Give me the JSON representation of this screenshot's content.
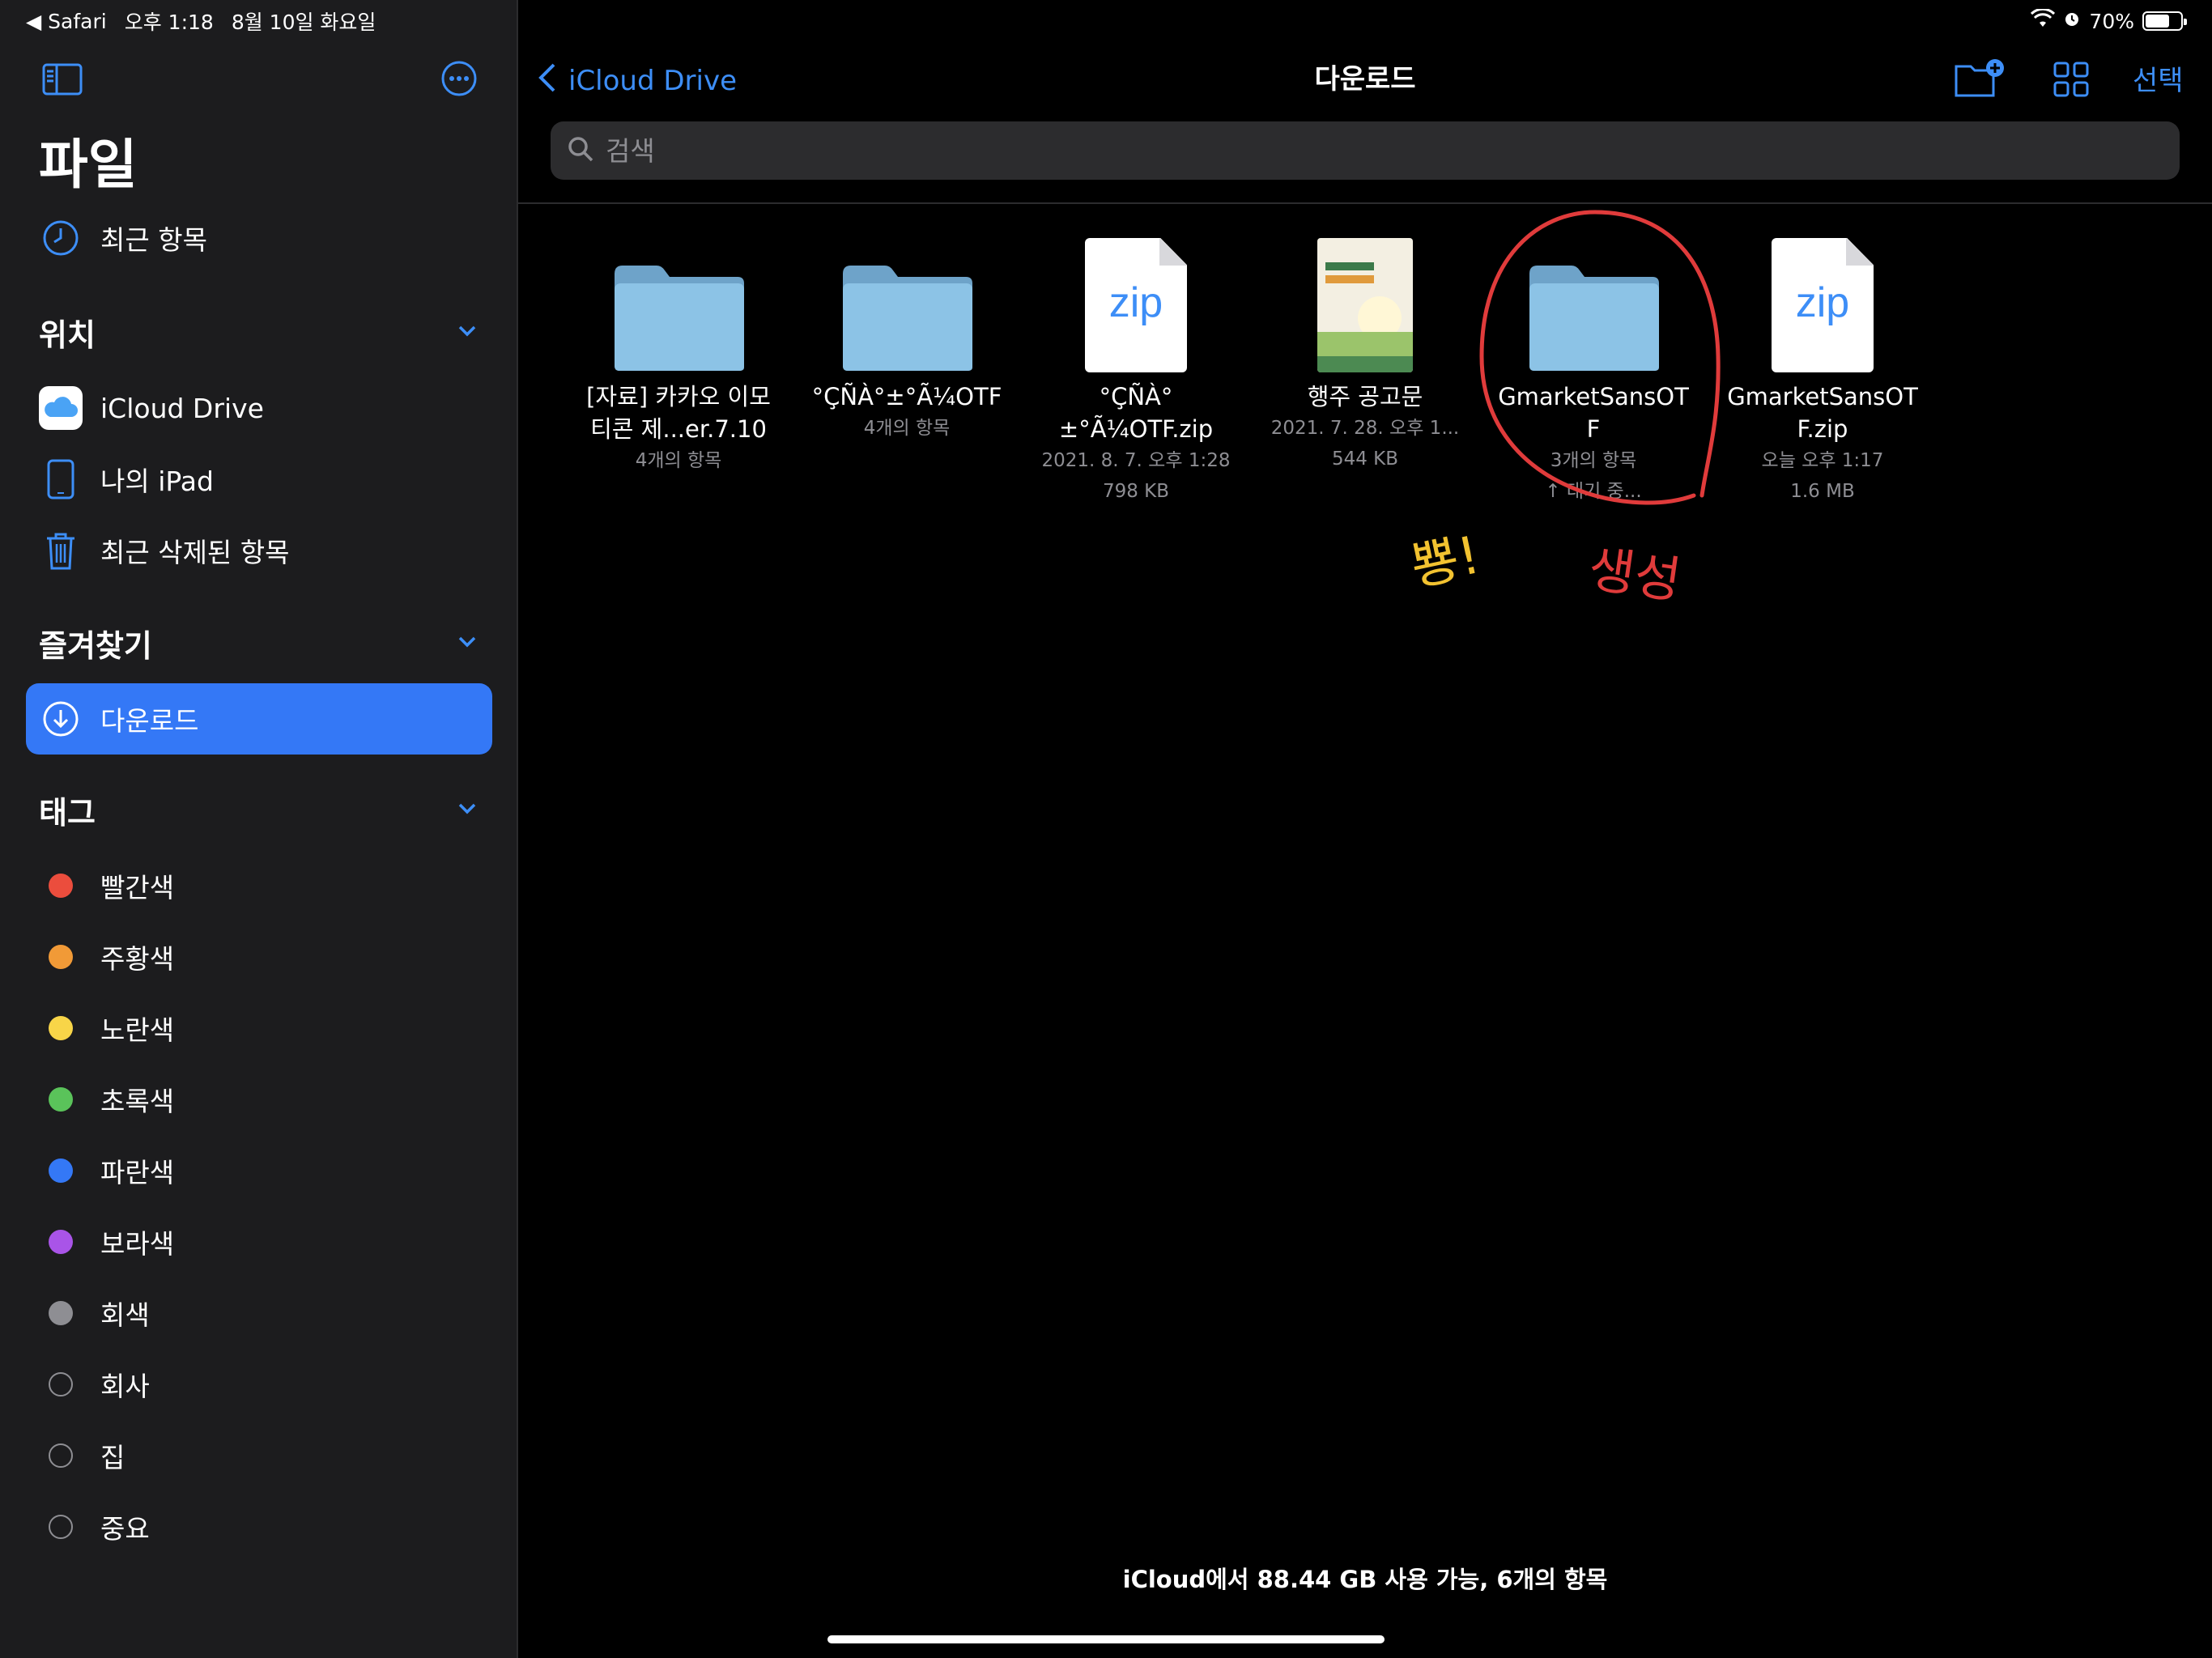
{
  "status_bar": {
    "back_app": "◀ Safari",
    "time": "오후 1:18",
    "date": "8월 10일 화요일",
    "battery": "70%",
    "battery_level": 0.7
  },
  "sidebar": {
    "title": "파일",
    "recents": "최근 항목",
    "locations_header": "위치",
    "locations": [
      {
        "label": "iCloud Drive",
        "icon": "icloud-icon"
      },
      {
        "label": "나의 iPad",
        "icon": "ipad-icon"
      },
      {
        "label": "최근 삭제된 항목",
        "icon": "trash-icon"
      }
    ],
    "favorites_header": "즐겨찾기",
    "favorites": [
      {
        "label": "다운로드",
        "icon": "download-icon",
        "selected": true
      }
    ],
    "tags_header": "태그",
    "tags": [
      {
        "label": "빨간색",
        "color": "#eb4d3d"
      },
      {
        "label": "주황색",
        "color": "#f19a37"
      },
      {
        "label": "노란색",
        "color": "#f8d548"
      },
      {
        "label": "초록색",
        "color": "#5ac35a"
      },
      {
        "label": "파란색",
        "color": "#3478f6"
      },
      {
        "label": "보라색",
        "color": "#a954e8"
      },
      {
        "label": "회색",
        "color": "#8e8e93"
      },
      {
        "label": "회사",
        "color": ""
      },
      {
        "label": "집",
        "color": ""
      },
      {
        "label": "중요",
        "color": ""
      }
    ]
  },
  "header": {
    "back_label": "iCloud Drive",
    "title": "다운로드",
    "select_label": "선택",
    "search_placeholder": "검색"
  },
  "files": [
    {
      "name_line1": "[자료] 카카오 이모",
      "name_line2": "티콘 제...er.7.10",
      "meta1": "4개의 항목",
      "meta2": "",
      "type": "folder"
    },
    {
      "name_line1": "°ÇÑÀ°±°Ã¼OTF",
      "name_line2": "",
      "meta1": "4개의 항목",
      "meta2": "",
      "type": "folder"
    },
    {
      "name_line1": "°ÇÑÀ°",
      "name_line2": "±°Ã¼OTF.zip",
      "meta1": "2021. 8. 7. 오후 1:28",
      "meta2": "798 KB",
      "type": "zip"
    },
    {
      "name_line1": "행주 공고문",
      "name_line2": "",
      "meta1": "2021. 7. 28. 오후 1...",
      "meta2": "544 KB",
      "type": "image"
    },
    {
      "name_line1": "GmarketSansOT",
      "name_line2": "F",
      "meta1": "3개의 항목",
      "meta2": "↑ 대기 중...",
      "type": "folder"
    },
    {
      "name_line1": "GmarketSansOT",
      "name_line2": "F.zip",
      "meta1": "오늘 오후 1:17",
      "meta2": "1.6 MB",
      "type": "zip"
    }
  ],
  "zip_label": "zip",
  "annotations": {
    "yellow_text": "뿅!",
    "red_text": "생성",
    "yellow_color": "#f2c230",
    "red_color": "#e03b3b"
  },
  "footer": "iCloud에서 88.44 GB 사용 가능, 6개의 항목",
  "colors": {
    "accent": "#3d8ef7",
    "sidebar_bg": "#1c1c1e",
    "selected_bg": "#3478f6",
    "folder": "#7fb6dc"
  }
}
